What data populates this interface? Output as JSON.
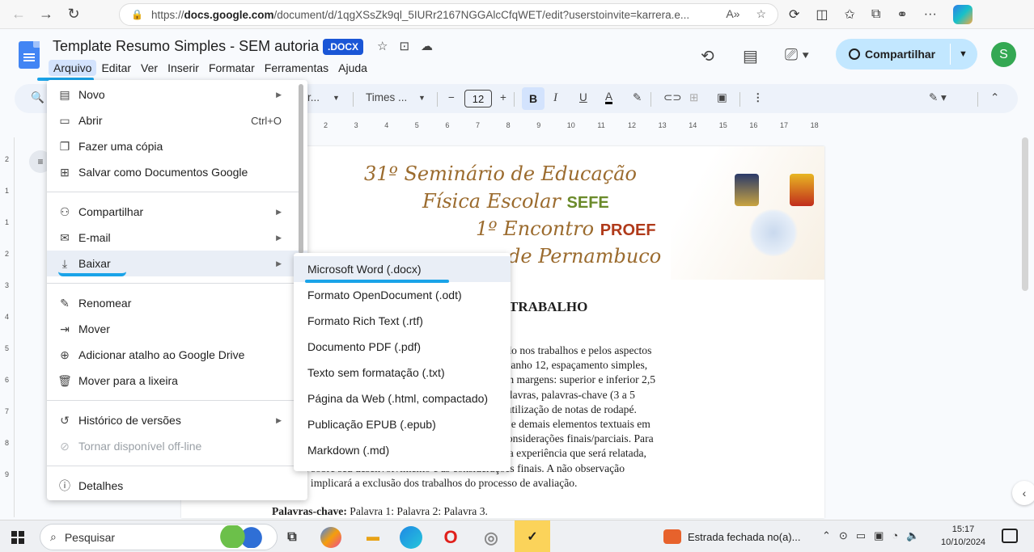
{
  "browser": {
    "url_prefix": "https://",
    "url_host": "docs.google.com",
    "url_path": "/document/d/1qgXSsZk9ql_5IURr2167NGGAlcCfqWET/edit?userstoinvite=karrera.e..."
  },
  "doc": {
    "title": "Template Resumo Simples - SEM autoria",
    "badge": ".DOCX",
    "menu": [
      "Arquivo",
      "Editar",
      "Ver",
      "Inserir",
      "Formatar",
      "Ferramentas",
      "Ajuda"
    ],
    "share_label": "Compartilhar",
    "avatar_letter": "S"
  },
  "toolbar": {
    "style_label": "r...",
    "font_label": "Times ...",
    "font_size": "12",
    "bold": "B",
    "italic": "I",
    "underline": "U",
    "text_color": "A"
  },
  "ruler": {
    "ticks": [
      "2",
      "3",
      "4",
      "5",
      "6",
      "7",
      "8",
      "9",
      "10",
      "11",
      "12",
      "13",
      "14",
      "15",
      "16",
      "17",
      "18"
    ],
    "vticks": [
      "2",
      "1",
      "1",
      "2",
      "3",
      "4",
      "5",
      "6",
      "7",
      "8",
      "9"
    ]
  },
  "page": {
    "banner_lines": [
      {
        "text": "31º Seminário de Educação",
        "strong": ""
      },
      {
        "text": "Física Escolar",
        "strong": "SEFE"
      },
      {
        "text": "1º Encontro",
        "strong": "PROEF"
      },
      {
        "text": "de Pernambuco",
        "strong": ""
      }
    ],
    "heading": "TRABALHO",
    "body_lines": [
      "apresentado nos trabalhos e pelos aspectos",
      "oman, tamanho 12, espaçamento simples,",
      "etrato, com margens: superior e inferior 2,5",
      "até 450 palavras, palavras-chave (3 a 5",
      "-se a não utilização de notas de rodapé.",
      "ntrodução e demais elementos textuais em",
      "ologia e considerações finais/parciais. Para",
      "objetivo da experiência que será relatada,"
    ],
    "tail_lines": [
      "eflexões sobre seu desenvolvimento e as considerações finais. A não observação",
      "critérios implicará a exclusão dos trabalhos do processo de avaliação."
    ],
    "keywords_label": "Palavras-chave:",
    "keywords_value": " Palavra 1: Palavra 2: Palavra 3."
  },
  "file_menu": {
    "items": [
      {
        "icon": "new-doc-icon",
        "glyph": "▤",
        "label": "Novo",
        "shortcut": "",
        "submenu": true
      },
      {
        "icon": "folder-icon",
        "glyph": "▭",
        "label": "Abrir",
        "shortcut": "Ctrl+O",
        "submenu": false
      },
      {
        "icon": "copy-icon",
        "glyph": "❐",
        "label": "Fazer uma cópia",
        "shortcut": "",
        "submenu": false
      },
      {
        "icon": "save-as-docs-icon",
        "glyph": "⊞",
        "label": "Salvar como Documentos Google",
        "shortcut": "",
        "submenu": false
      },
      {
        "icon": "share-person-icon",
        "glyph": "⚇",
        "label": "Compartilhar",
        "shortcut": "",
        "submenu": true
      },
      {
        "icon": "mail-icon",
        "glyph": "✉",
        "label": "E-mail",
        "shortcut": "",
        "submenu": true
      },
      {
        "icon": "download-icon",
        "glyph": "⤓",
        "label": "Baixar",
        "shortcut": "",
        "submenu": true
      },
      {
        "icon": "rename-icon",
        "glyph": "✎",
        "label": "Renomear",
        "shortcut": "",
        "submenu": false
      },
      {
        "icon": "move-icon",
        "glyph": "⇥",
        "label": "Mover",
        "shortcut": "",
        "submenu": false
      },
      {
        "icon": "drive-shortcut-icon",
        "glyph": "⊕",
        "label": "Adicionar atalho ao Google Drive",
        "shortcut": "",
        "submenu": false
      },
      {
        "icon": "trash-icon",
        "glyph": "🗑",
        "label": "Mover para a lixeira",
        "shortcut": "",
        "submenu": false
      },
      {
        "icon": "history-icon",
        "glyph": "↺",
        "label": "Histórico de versões",
        "shortcut": "",
        "submenu": true
      },
      {
        "icon": "offline-icon",
        "glyph": "⊘",
        "label": "Tornar disponível off-line",
        "shortcut": "",
        "submenu": false
      },
      {
        "icon": "info-icon",
        "glyph": "ⓘ",
        "label": "Detalhes",
        "shortcut": "",
        "submenu": false
      }
    ]
  },
  "download_menu": {
    "items": [
      "Microsoft Word (.docx)",
      "Formato OpenDocument (.odt)",
      "Formato Rich Text (.rtf)",
      "Documento PDF (.pdf)",
      "Texto sem formatação (.txt)",
      "Página da Web (.html, compactado)",
      "Publicação EPUB (.epub)",
      "Markdown (.md)"
    ]
  },
  "taskbar": {
    "search_placeholder": "Pesquisar",
    "weather_text": "Estrada fechada no(a)...",
    "time": "15:17",
    "date": "10/10/2024"
  },
  "colors": {
    "accent_blue": "#1aa3e8",
    "share_bg": "#c2e7ff",
    "docx_badge": "#1a56d6",
    "menu_highlight": "#e9eef6"
  }
}
